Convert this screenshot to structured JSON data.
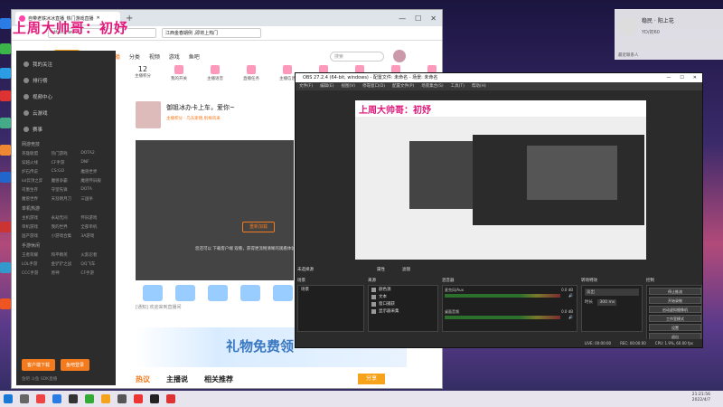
{
  "overlay_title": "上周大帅哥：初妤",
  "browser": {
    "tab_title": "自带老铁冰冰直播_热门游戏直播",
    "url_text": "https://www",
    "search_text": "江西金春期例 ,即将上热门",
    "window_controls": [
      "—",
      "☐",
      "✕"
    ]
  },
  "site": {
    "logo": "斗鱼",
    "nav": [
      "首页",
      "直播",
      "分类",
      "视频",
      "游戏",
      "鱼吧"
    ],
    "search_placeholder": "搜索"
  },
  "sidebar": {
    "items": [
      "我的关注",
      "排行榜",
      "视频中心",
      "云游戏",
      "赛事"
    ],
    "section_game": "网游竞技",
    "games": [
      "英雄联盟",
      "热门游戏",
      "DOTA2",
      "穿越火线",
      "CF手游",
      "DNF",
      "炉石传说",
      "CS:GO",
      "魔兽世界",
      "lol云顶之弈",
      "魔兽争霸",
      "魔兽怀旧服",
      "司墨生存",
      "守望先锋",
      "DOTA",
      "魔兽世界",
      "天涯明月刀",
      "三国杀"
    ],
    "section_single": "单机热游",
    "singles": [
      "主机游戏",
      "永劫无间",
      "怀旧游戏",
      "单机游戏",
      "我的世界",
      "全部单机",
      "国产游戏",
      "小游戏合集",
      "3A游戏"
    ],
    "section_mobile": "手游休闲",
    "mobiles": [
      "王者荣耀",
      "和平精英",
      "火影忍者",
      "LOL手游",
      "金铲铲之战",
      "QQ飞车",
      "CCC手游",
      "原神",
      "CF手游"
    ],
    "btn1": "客户端下载",
    "btn2": "鱼吧登录",
    "footer": "鱼吧 斗鱼 SDK直播"
  },
  "main": {
    "stats": [
      {
        "num": "12",
        "label": "主播积分"
      },
      {
        "num": "",
        "label": "我的开关"
      },
      {
        "num": "",
        "label": "主播语音"
      },
      {
        "num": "",
        "label": "直播任务"
      },
      {
        "num": "",
        "label": "主播信息"
      },
      {
        "num": "",
        "label": "主播话题"
      },
      {
        "num": "",
        "label": "工作台"
      },
      {
        "num": "",
        "label": "分享"
      },
      {
        "num": "",
        "label": "客户端"
      }
    ],
    "streamer_title": "御姐冰办卡上车，爱你~",
    "streamer_tags": "主播积分  ·  乌东斯德,别样风采",
    "video_msg": "您还可以 下载客户端 观看，获得更流畅清晰的观看体验",
    "video_btn": "重新加载",
    "chat_line": "[通知] 欢迎来到直播间",
    "banner_text": "礼物免费领",
    "bottom_tabs": [
      "热议",
      "主播说",
      "相关推荐"
    ],
    "share": "分享"
  },
  "obs": {
    "title": "OBS 27.2.4 (64-bit, windows) - 配置文件: 未命名 - 场景: 未命名",
    "menu": [
      "文件(F)",
      "编辑(E)",
      "视图(V)",
      "停靠窗口(D)",
      "配置文件(P)",
      "场景集合(S)",
      "工具(T)",
      "帮助(H)"
    ],
    "canvas_title": "上周大帅哥：初妤",
    "no_source": "未选择源",
    "props": "属性",
    "filters": "滤镜",
    "scenes_hdr": "场景",
    "sources_hdr": "来源",
    "mixer_hdr": "混音器",
    "trans_hdr": "转场特效",
    "ctl_hdr": "控制",
    "scene_item": "场景",
    "sources": [
      "颜色源",
      "文本",
      "窗口捕获",
      "显示器采集"
    ],
    "mixer_rows": [
      {
        "name": "麦克风/Aux",
        "db": "0.0 dB"
      },
      {
        "name": "桌面音频",
        "db": "0.0 dB"
      }
    ],
    "trans_type": "淡出",
    "duration_label": "时长",
    "duration": "300 ms",
    "controls": [
      "停止推流",
      "开始录制",
      "启动虚拟摄像机",
      "工作室模式",
      "设置",
      "退出"
    ],
    "status": [
      "LIVE: 00:00:00",
      "REC: 00:00:00",
      "CPU: 1.9%, 60.00 fps"
    ]
  },
  "qq": {
    "name": "稳民 · 阳上花",
    "sub": "YD/初60",
    "label": "最近联系人"
  },
  "taskbar": {
    "time": "21:21:56",
    "date": "2022/4/7"
  }
}
